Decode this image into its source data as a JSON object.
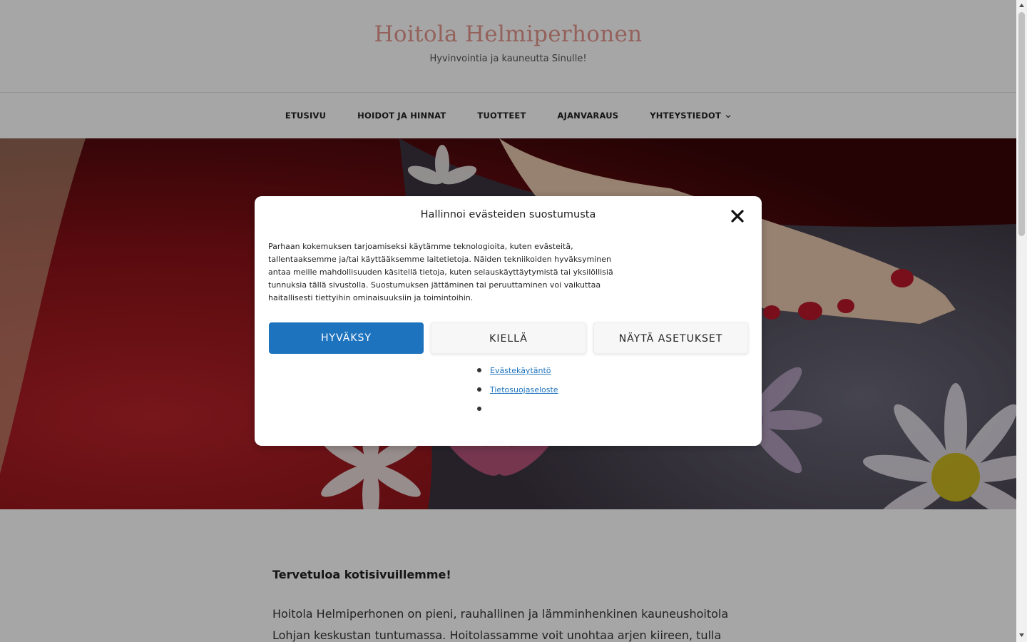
{
  "site": {
    "title": "Hoitola Helmiperhonen",
    "tagline": "Hyvinvointia ja kauneutta Sinulle!"
  },
  "nav": {
    "items": [
      {
        "label": "ETUSIVU"
      },
      {
        "label": "HOIDOT JA HINNAT"
      },
      {
        "label": "TUOTTEET"
      },
      {
        "label": "AJANVARAUS"
      },
      {
        "label": "YHTEYSTIEDOT",
        "has_dropdown": true
      }
    ]
  },
  "content": {
    "welcome": "Tervetuloa kotisivuillemme!",
    "intro": "Hoitola Helmiperhonen on pieni, rauhallinen ja lämminhenkinen kauneushoitola Lohjan keskustan tuntumassa. Hoitolassamme voit unohtaa arjen kiireen, tulla rentoutumaan ja"
  },
  "cookie_modal": {
    "title": "Hallinnoi evästeiden suostumusta",
    "body": "Parhaan kokemuksen tarjoamiseksi käytämme teknologioita, kuten evästeitä, tallentaaksemme ja/tai käyttääksemme laitetietoja. Näiden tekniikoiden hyväksyminen antaa meille mahdollisuuden käsitellä tietoja, kuten selauskäyttäytymistä tai yksilöllisiä tunnuksia tällä sivustolla. Suostumuksen jättäminen tai peruuttaminen voi vaikuttaa haitallisesti tiettyihin ominaisuuksiin ja toimintoihin.",
    "accept_label": "HYVÄKSY",
    "deny_label": "KIELLÄ",
    "settings_label": "NÄYTÄ ASETUKSET",
    "links": [
      "Evästekäytäntö",
      "Tietosuojaseloste",
      ""
    ],
    "close_icon": "close-icon"
  },
  "colors": {
    "title": "#e3968c",
    "accept": "#1e73be",
    "link": "#1e73be"
  }
}
